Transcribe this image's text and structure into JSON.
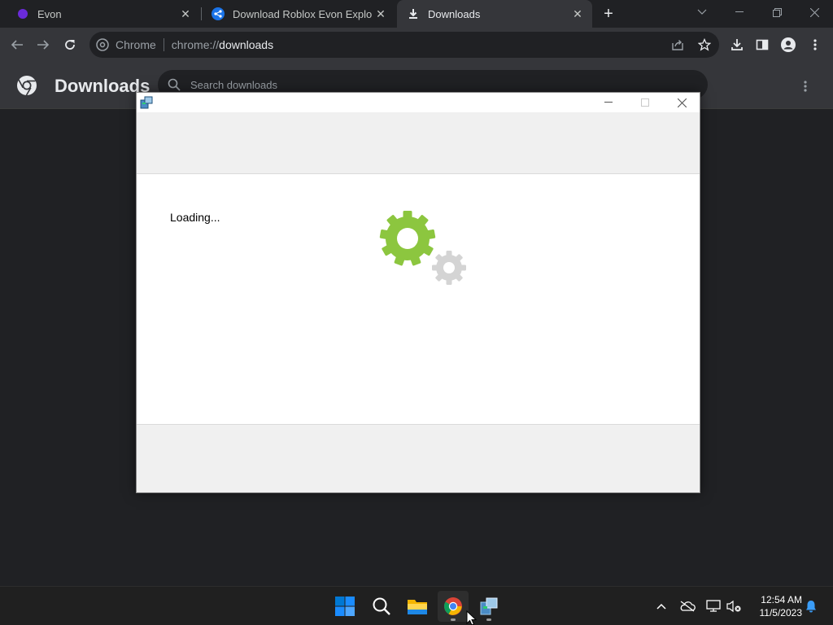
{
  "browser": {
    "tabs": [
      {
        "title": "Evon",
        "icon": "evon-favicon-icon",
        "active": false
      },
      {
        "title": "Download Roblox Evon Exploit V",
        "icon": "share-favicon-icon",
        "active": false
      },
      {
        "title": "Downloads",
        "icon": "download-favicon-icon",
        "active": true
      }
    ],
    "omnibox": {
      "site_label": "Chrome",
      "url_scheme": "chrome://",
      "url_path": "downloads"
    }
  },
  "downloads_page": {
    "title": "Downloads",
    "search_placeholder": "Search downloads"
  },
  "dialog": {
    "status_text": "Loading...",
    "gear_colors": {
      "primary": "#8cc63f",
      "secondary": "#d4d4d4"
    }
  },
  "taskbar": {
    "apps": [
      "start-icon",
      "search-icon",
      "file-explorer-icon",
      "chrome-icon",
      "installer-app-icon"
    ],
    "clock": {
      "time": "12:54 AM",
      "date": "11/5/2023"
    }
  }
}
